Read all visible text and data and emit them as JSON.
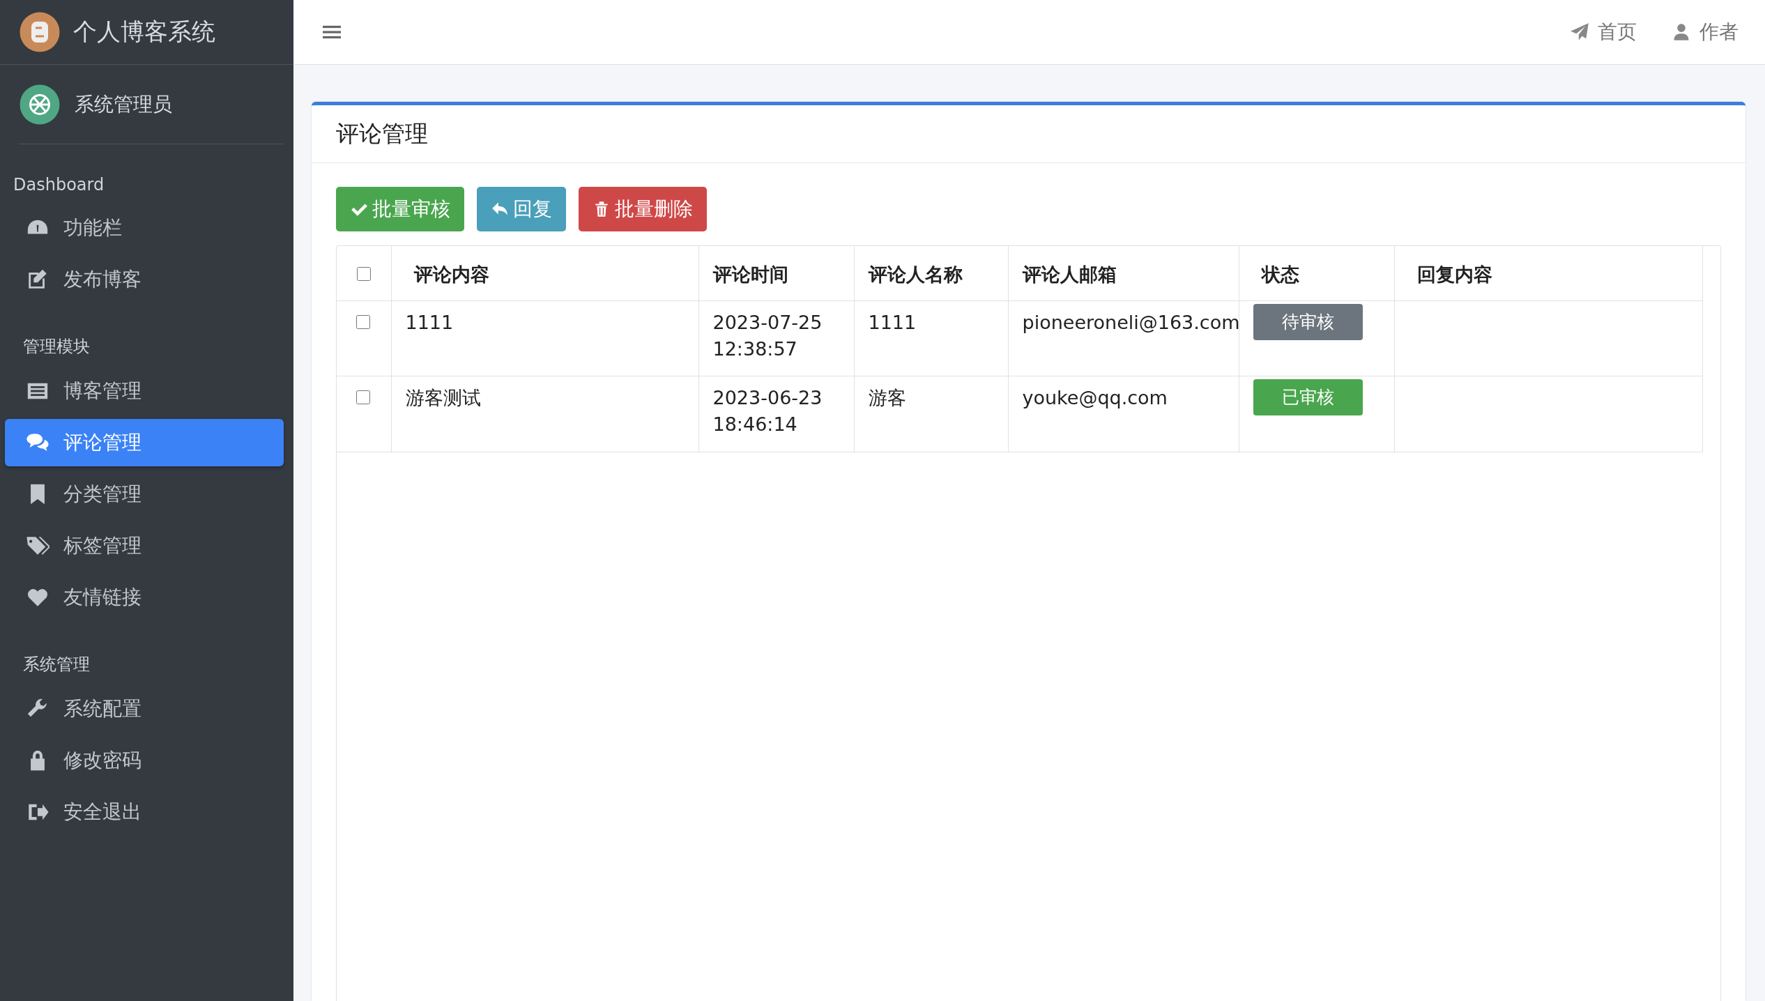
{
  "sidebar": {
    "brand": "个人博客系统",
    "user": "系统管理员",
    "sections": [
      {
        "heading": "Dashboard",
        "items": [
          {
            "label": "功能栏",
            "kind": "gauge",
            "selected": false
          },
          {
            "label": "发布博客",
            "kind": "edit",
            "selected": false
          }
        ]
      },
      {
        "heading": "管理模块",
        "items": [
          {
            "label": "博客管理",
            "kind": "list",
            "selected": false
          },
          {
            "label": "评论管理",
            "kind": "comments",
            "selected": true
          },
          {
            "label": "分类管理",
            "kind": "bookmark",
            "selected": false
          },
          {
            "label": "标签管理",
            "kind": "tags",
            "selected": false
          },
          {
            "label": "友情链接",
            "kind": "heart",
            "selected": false
          }
        ]
      },
      {
        "heading": "系统管理",
        "items": [
          {
            "label": "系统配置",
            "kind": "wrench",
            "selected": false
          },
          {
            "label": "修改密码",
            "kind": "lock",
            "selected": false
          },
          {
            "label": "安全退出",
            "kind": "exit",
            "selected": false
          }
        ]
      }
    ]
  },
  "topbar": {
    "links": [
      {
        "label": "首页",
        "kind": "send"
      },
      {
        "label": "作者",
        "kind": "user"
      }
    ]
  },
  "card": {
    "title": "评论管理",
    "buttons": [
      {
        "label": "批量审核",
        "kind": "approve"
      },
      {
        "label": "回复",
        "kind": "reply"
      },
      {
        "label": "批量删除",
        "kind": "delete"
      }
    ],
    "table": {
      "header_checked": false,
      "columns": [
        "评论内容",
        "评论时间",
        "评论人名称",
        "评论人邮箱",
        "状态",
        "回复内容"
      ],
      "rows": [
        {
          "checked": false,
          "content": "1111",
          "time": [
            "2023-07-25",
            "12:38:57"
          ],
          "name": "1111",
          "email": "pioneeroneli@163.com",
          "status": {
            "label": "待审核",
            "kind": "pending"
          }
        },
        {
          "checked": false,
          "content": "游客测试",
          "time": [
            "2023-06-23",
            "18:46:14"
          ],
          "name": "游客",
          "email": "youke@qq.com",
          "status": {
            "label": "已审核",
            "kind": "approved"
          }
        }
      ]
    }
  }
}
